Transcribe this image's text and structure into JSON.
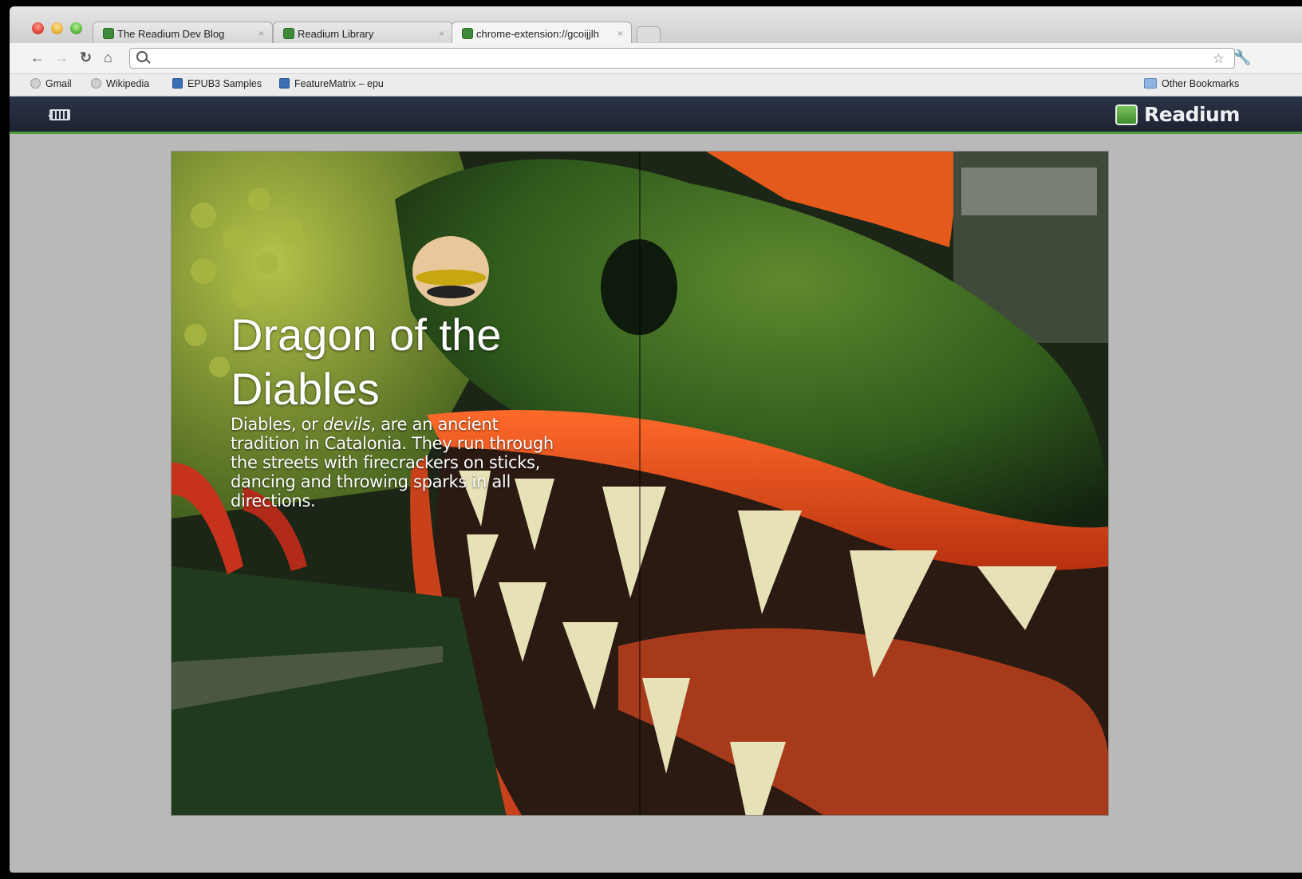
{
  "browser": {
    "tabs": [
      {
        "title": "The Readium Dev Blog",
        "close": "×"
      },
      {
        "title": "Readium Library",
        "close": "×"
      },
      {
        "title": "chrome-extension://gcoijjlh",
        "close": "×"
      }
    ],
    "address": {
      "value": "",
      "placeholder": ""
    },
    "bookmarks": [
      "Gmail",
      "Wikipedia",
      "EPUB3 Samples",
      "FeatureMatrix – epu"
    ],
    "other_bookmarks": "Other Bookmarks"
  },
  "app": {
    "brand": "Readium",
    "library_icon": "library-grid-icon"
  },
  "book": {
    "title": "Dragon of the Diables",
    "body_pre": "Diables, or ",
    "body_em": "devils",
    "body_post": ", are an ancient tradition in Catalonia. They run through the streets with firecrackers on sticks, dancing and throwing sparks in all directions."
  },
  "icons": {
    "back": "back-arrow-icon",
    "forward": "forward-arrow-icon",
    "reload": "reload-icon",
    "home": "home-icon",
    "star": "star-icon",
    "wrench": "wrench-icon"
  }
}
